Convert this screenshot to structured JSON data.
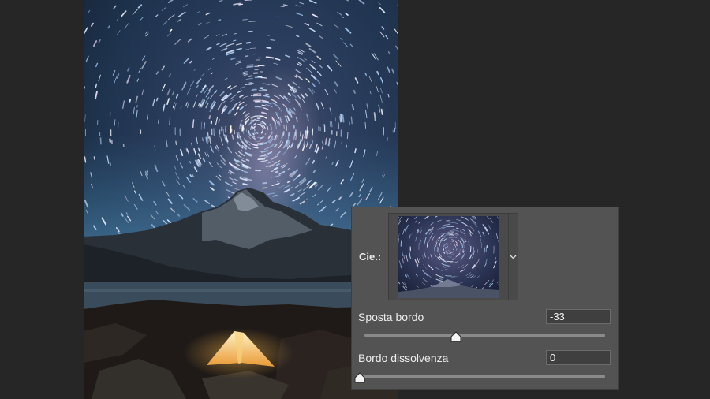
{
  "panel": {
    "sky_label": "Cie.:",
    "shift_edge": {
      "label": "Sposta bordo",
      "value": "-33",
      "fraction": 0.38
    },
    "fade_edge": {
      "label": "Bordo dissolvenza",
      "value": "0",
      "fraction": 0.0
    }
  },
  "icons": {
    "dropdown": "chevron-down-icon",
    "slider_handle": "slider-thumb-icon"
  },
  "colors": {
    "panel_bg": "#535353",
    "app_bg": "#262626",
    "field_bg": "#3f3f3f",
    "tent_glow": "#f4b24a"
  }
}
